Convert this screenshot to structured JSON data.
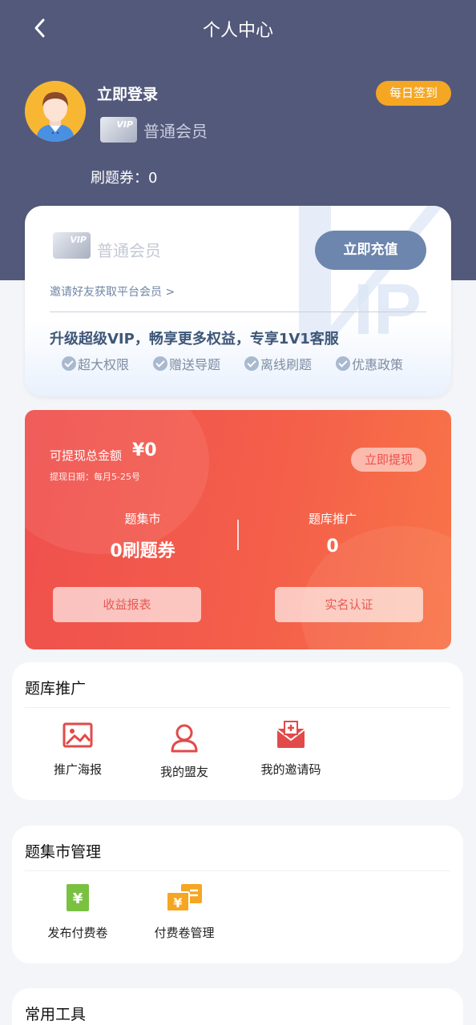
{
  "header": {
    "title": "个人中心",
    "back_icon": "back-arrow-icon"
  },
  "user": {
    "login_label": "立即登录",
    "vip_card_text": "VIP",
    "member_level": "普通会员",
    "checkin_label": "每日签到",
    "coupon_label": "刷题券：",
    "coupon_count": "0"
  },
  "vip_panel": {
    "card_text": "VIP",
    "member_level": "普通会员",
    "recharge_label": "立即充值",
    "invite_text": "邀请好友获取平台会员 >",
    "upgrade_text": "升级超级VIP，畅享更多权益，专享1V1客服",
    "benefits": [
      "超大权限",
      "赠送导题",
      "离线刷题",
      "优惠政策"
    ]
  },
  "earnings": {
    "total_label": "可提现总金额",
    "total_value": "¥0",
    "date_text": "提现日期：每月5-25号",
    "withdraw_label": "立即提现",
    "col1_label": "题集市",
    "col1_value": "0刷题券",
    "col2_label": "题库推广",
    "col2_value": "0",
    "report_label": "收益报表",
    "verify_label": "实名认证"
  },
  "promo_section": {
    "title": "题库推广",
    "items": [
      {
        "label": "推广海报",
        "icon": "image-icon"
      },
      {
        "label": "我的盟友",
        "icon": "user-icon"
      },
      {
        "label": "我的邀请码",
        "icon": "invite-mail-icon"
      }
    ]
  },
  "market_section": {
    "title": "题集市管理",
    "items": [
      {
        "label": "发布付费卷",
        "icon": "yen-doc-icon"
      },
      {
        "label": "付费卷管理",
        "icon": "yen-tickets-icon"
      }
    ]
  },
  "tools_section": {
    "title": "常用工具"
  },
  "colors": {
    "header_bg": "#53597b",
    "accent_orange": "#f5a623",
    "earn_red": "#ef4f4d",
    "recharge_blue": "#6d86ad",
    "icon_red": "#e24a4a",
    "icon_green": "#7ac142",
    "icon_orange": "#f5a623"
  }
}
